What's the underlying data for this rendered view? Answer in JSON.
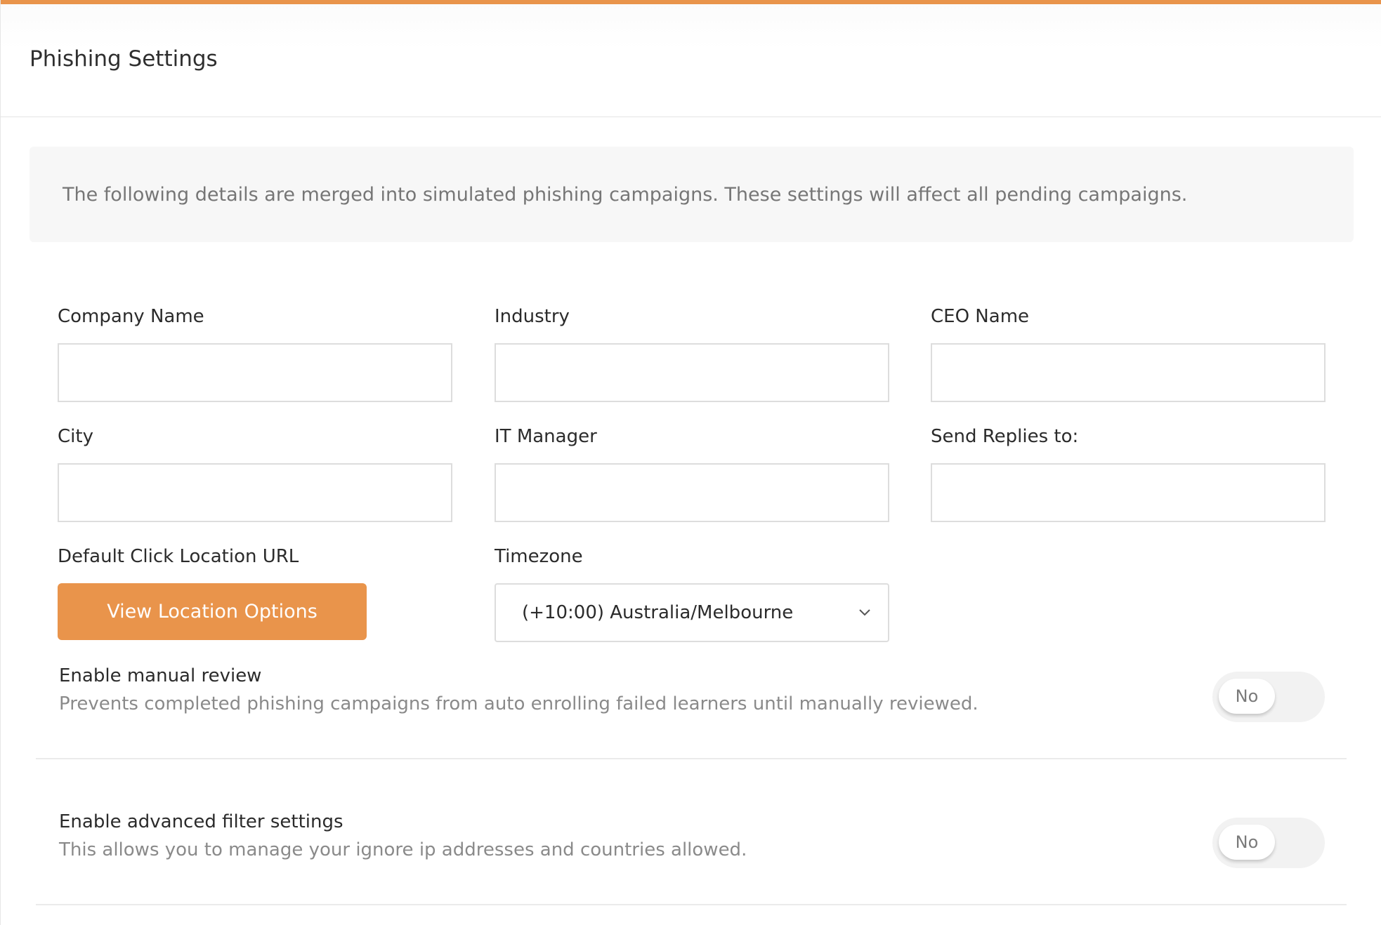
{
  "header": {
    "title": "Phishing Settings"
  },
  "info": {
    "text": "The following details are merged into simulated phishing campaigns. These settings will affect all pending campaigns."
  },
  "form": {
    "company_name": {
      "label": "Company Name",
      "value": ""
    },
    "industry": {
      "label": "Industry",
      "value": ""
    },
    "ceo_name": {
      "label": "CEO Name",
      "value": ""
    },
    "city": {
      "label": "City",
      "value": ""
    },
    "it_manager": {
      "label": "IT Manager",
      "value": ""
    },
    "send_replies_to": {
      "label": "Send Replies to:",
      "value": ""
    },
    "default_click_location": {
      "label": "Default Click Location URL",
      "button_label": "View Location Options"
    },
    "timezone": {
      "label": "Timezone",
      "selected": "(+10:00) Australia/Melbourne"
    }
  },
  "settings": {
    "manual_review": {
      "title": "Enable manual review",
      "description": "Prevents completed phishing campaigns from auto enrolling failed learners until manually reviewed.",
      "toggle_label": "No"
    },
    "advanced_filter": {
      "title": "Enable advanced filter settings",
      "description": "This allows you to manage your ignore ip addresses and countries allowed.",
      "toggle_label": "No"
    }
  },
  "colors": {
    "accent": "#E9944B",
    "info_background": "#F7F7F7",
    "border": "#DDDDDD"
  },
  "icons": {
    "timezone_dropdown": "chevron-down-icon"
  }
}
